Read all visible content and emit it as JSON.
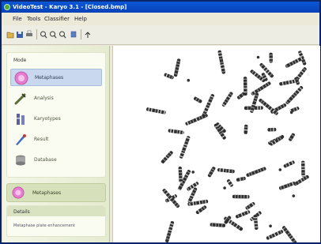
{
  "window": {
    "title": "VideoTest - Karyo 3.1 - [Closed.bmp]"
  },
  "menu": [
    "File",
    "Tools",
    "Classifier",
    "Help"
  ],
  "toolbar": {
    "icons": [
      "open-icon",
      "save-icon",
      "print-icon",
      "zoom-in-icon",
      "zoom-out-icon",
      "zoom-fit-icon",
      "settings-icon",
      "help-icon"
    ]
  },
  "sidebar": {
    "mode_header": "Mode",
    "items": [
      {
        "label": "Metaphases",
        "icon": "metaphase-icon",
        "selected": true
      },
      {
        "label": "Analysis",
        "icon": "analysis-icon",
        "selected": false
      },
      {
        "label": "Karyotypes",
        "icon": "karyotype-icon",
        "selected": false
      },
      {
        "label": "Result",
        "icon": "result-icon",
        "selected": false
      },
      {
        "label": "Database",
        "icon": "database-icon",
        "selected": false
      }
    ],
    "current_mode": "Metaphases",
    "details_header": "Details",
    "details_text": "Metaphase plate enhancement"
  }
}
